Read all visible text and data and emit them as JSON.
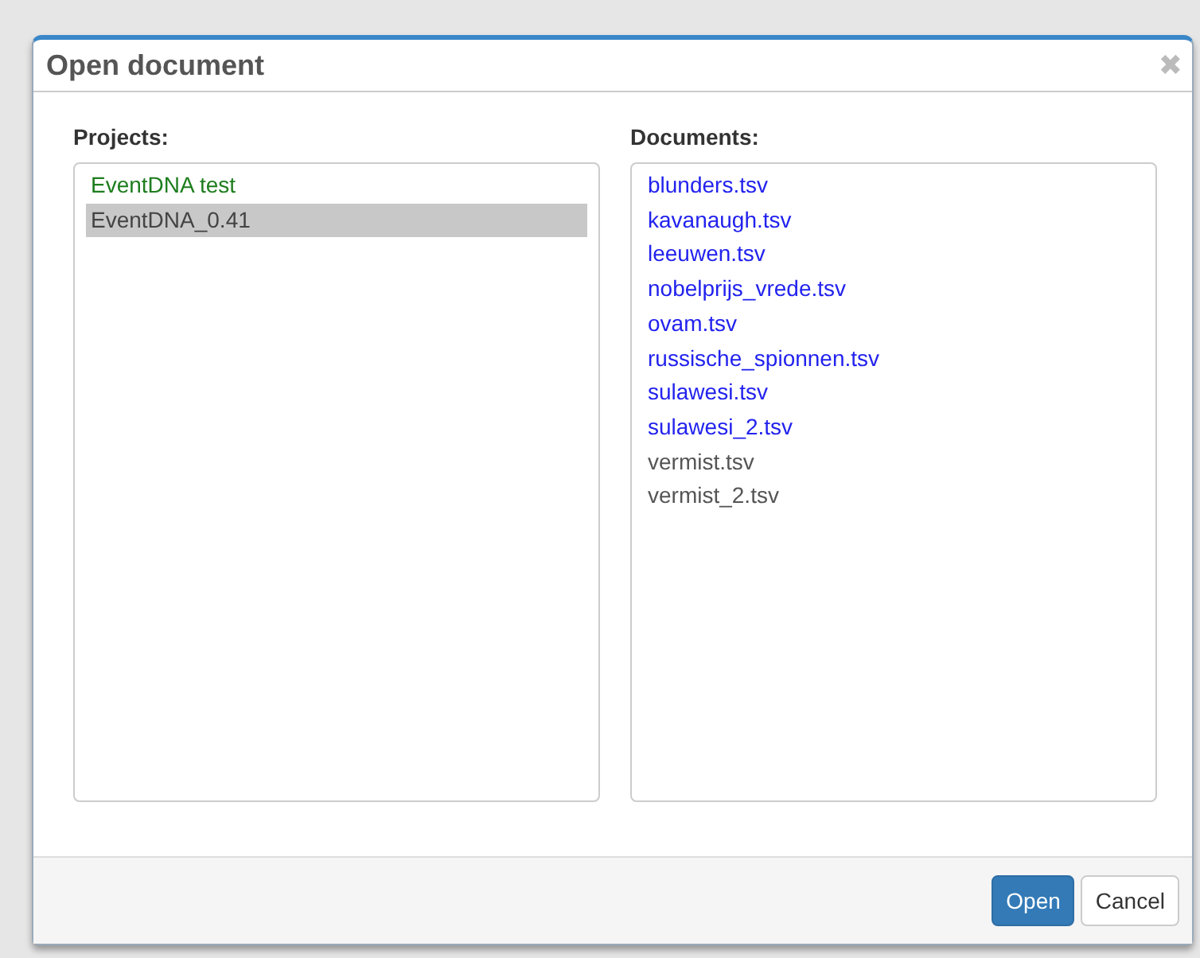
{
  "dialog": {
    "title": "Open document",
    "close": "✖"
  },
  "projects": {
    "label": "Projects:",
    "items": [
      {
        "name": "EventDNA test",
        "color": "#1e7d1e",
        "selected": false
      },
      {
        "name": "EventDNA_0.41",
        "color": "#444444",
        "selected": true
      }
    ]
  },
  "documents": {
    "label": "Documents:",
    "items": [
      {
        "name": "blunders.tsv",
        "color": "#2222ee",
        "selected": false
      },
      {
        "name": "kavanaugh.tsv",
        "color": "#2222ee",
        "selected": false
      },
      {
        "name": "leeuwen.tsv",
        "color": "#2222ee",
        "selected": false
      },
      {
        "name": "nobelprijs_vrede.tsv",
        "color": "#2222ee",
        "selected": false
      },
      {
        "name": "ovam.tsv",
        "color": "#2222ee",
        "selected": false
      },
      {
        "name": "russische_spionnen.tsv",
        "color": "#2222ee",
        "selected": false
      },
      {
        "name": "sulawesi.tsv",
        "color": "#2222ee",
        "selected": false
      },
      {
        "name": "sulawesi_2.tsv",
        "color": "#2222ee",
        "selected": false
      },
      {
        "name": "vermist.tsv",
        "color": "#555555",
        "selected": false
      },
      {
        "name": "vermist_2.tsv",
        "color": "#555555",
        "selected": false
      }
    ]
  },
  "buttons": [
    {
      "label": "Open",
      "kind": "primary"
    },
    {
      "label": "Cancel",
      "kind": "default"
    }
  ]
}
